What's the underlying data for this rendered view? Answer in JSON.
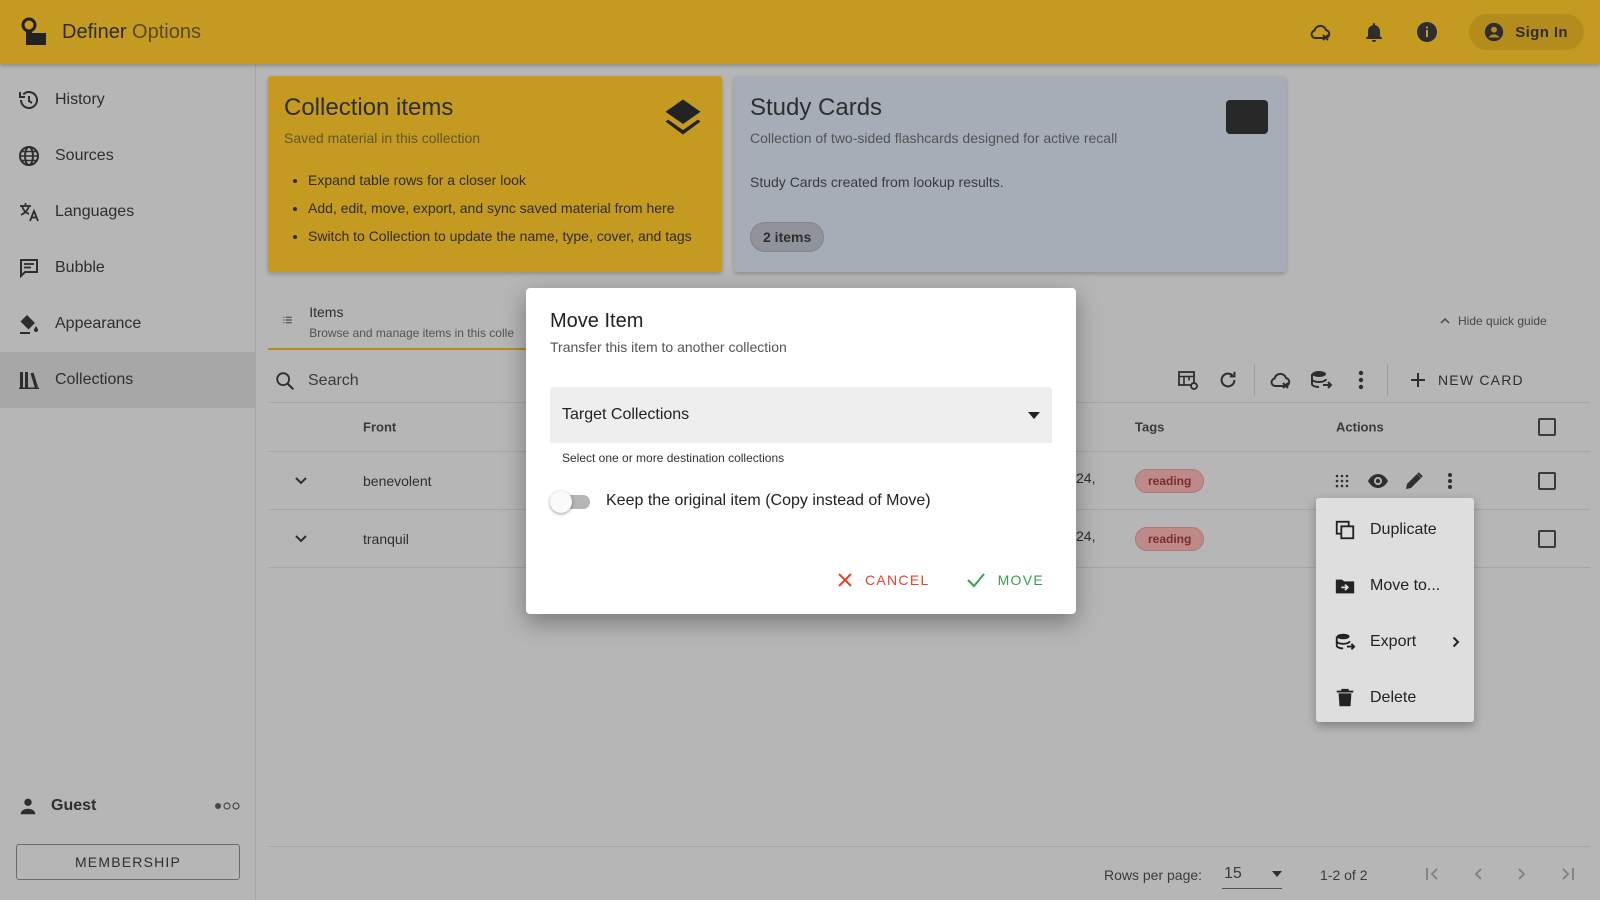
{
  "app": {
    "title_main": "Definer",
    "title_sub": "Options",
    "sign_in": "Sign In"
  },
  "sidebar": {
    "items": [
      {
        "label": "History",
        "icon": "history-icon"
      },
      {
        "label": "Sources",
        "icon": "globe-icon"
      },
      {
        "label": "Languages",
        "icon": "translate-icon"
      },
      {
        "label": "Bubble",
        "icon": "bubble-icon"
      },
      {
        "label": "Appearance",
        "icon": "paint-icon"
      },
      {
        "label": "Collections",
        "icon": "library-icon"
      }
    ],
    "active": "Collections",
    "user": "Guest",
    "membership": "MEMBERSHIP"
  },
  "cards": {
    "collection": {
      "title": "Collection items",
      "subtitle": "Saved material in this collection",
      "bullets": [
        "Expand table rows for a closer look",
        "Add, edit, move, export, and sync saved material from here",
        "Switch to Collection to update the name, type, cover, and tags"
      ]
    },
    "study": {
      "title": "Study Cards",
      "subtitle": "Collection of two-sided flashcards designed for active recall",
      "description": "Study Cards created from lookup results.",
      "chip": "2 items"
    }
  },
  "items_tab": {
    "title": "Items",
    "subtitle": "Browse and manage items in this colle"
  },
  "quick_guide": "Hide quick guide",
  "search": {
    "placeholder": "Search"
  },
  "toolbar": {
    "new_card": "NEW CARD"
  },
  "table": {
    "headers": {
      "front": "Front",
      "tags": "Tags",
      "actions": "Actions"
    },
    "rows": [
      {
        "front": "benevolent",
        "date_fragment": "24,",
        "tag": "reading"
      },
      {
        "front": "tranquil",
        "date_fragment": "24,",
        "tag": "reading"
      }
    ]
  },
  "footer": {
    "rows_per_page_label": "Rows per page:",
    "rows_per_page": "15",
    "page_info": "1-2 of 2"
  },
  "menu": {
    "duplicate": "Duplicate",
    "move_to": "Move to...",
    "export": "Export",
    "delete": "Delete"
  },
  "dialog": {
    "title": "Move Item",
    "subtitle": "Transfer this item to another collection",
    "select_label": "Target Collections",
    "helper": "Select one or more destination collections",
    "toggle_label": "Keep the original item (Copy instead of Move)",
    "toggle_on": false,
    "cancel": "CANCEL",
    "move": "MOVE"
  },
  "colors": {
    "accent": "#f2b70f",
    "study_card": "#c9d1e0",
    "cancel": "#e0442c",
    "move": "#3aa04a",
    "tag": "#e9a0a0"
  }
}
